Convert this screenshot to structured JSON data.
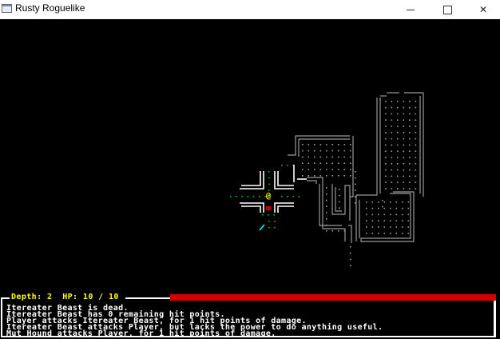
{
  "window": {
    "title": "Rusty Roguelike",
    "buttons": {
      "minimize": "minimize",
      "maximize": "maximize",
      "close": "✕"
    }
  },
  "hud": {
    "depth_label": "Depth:",
    "depth": "2",
    "hp_label": "HP:",
    "hp_current": "10",
    "hp_max": "10",
    "hp_fraction": 1.0,
    "hp_bar_color": "#d40000",
    "stats_color": "#ffff00",
    "log": [
      "Itereater Beast is dead.",
      "Itereater Beast has 0 remaining hit points.",
      "Player attacks Itereater Beast, for 1 hit points of damage.",
      "Itereater Beast attacks Player, but lacks the power to do anything useful.",
      "Mut Hound attacks Player, for 1 hit points of damage."
    ]
  },
  "map": {
    "player_glyph": "@",
    "player_color": "#ffff00",
    "blood_color": "#c00000",
    "item_color": "#00ffff",
    "floor_visible_color": "#00c000",
    "floor_remembered_color": "#9a9a9a",
    "wall_visible_color": "#ffffff",
    "wall_remembered_color": "#9a9a9a"
  }
}
